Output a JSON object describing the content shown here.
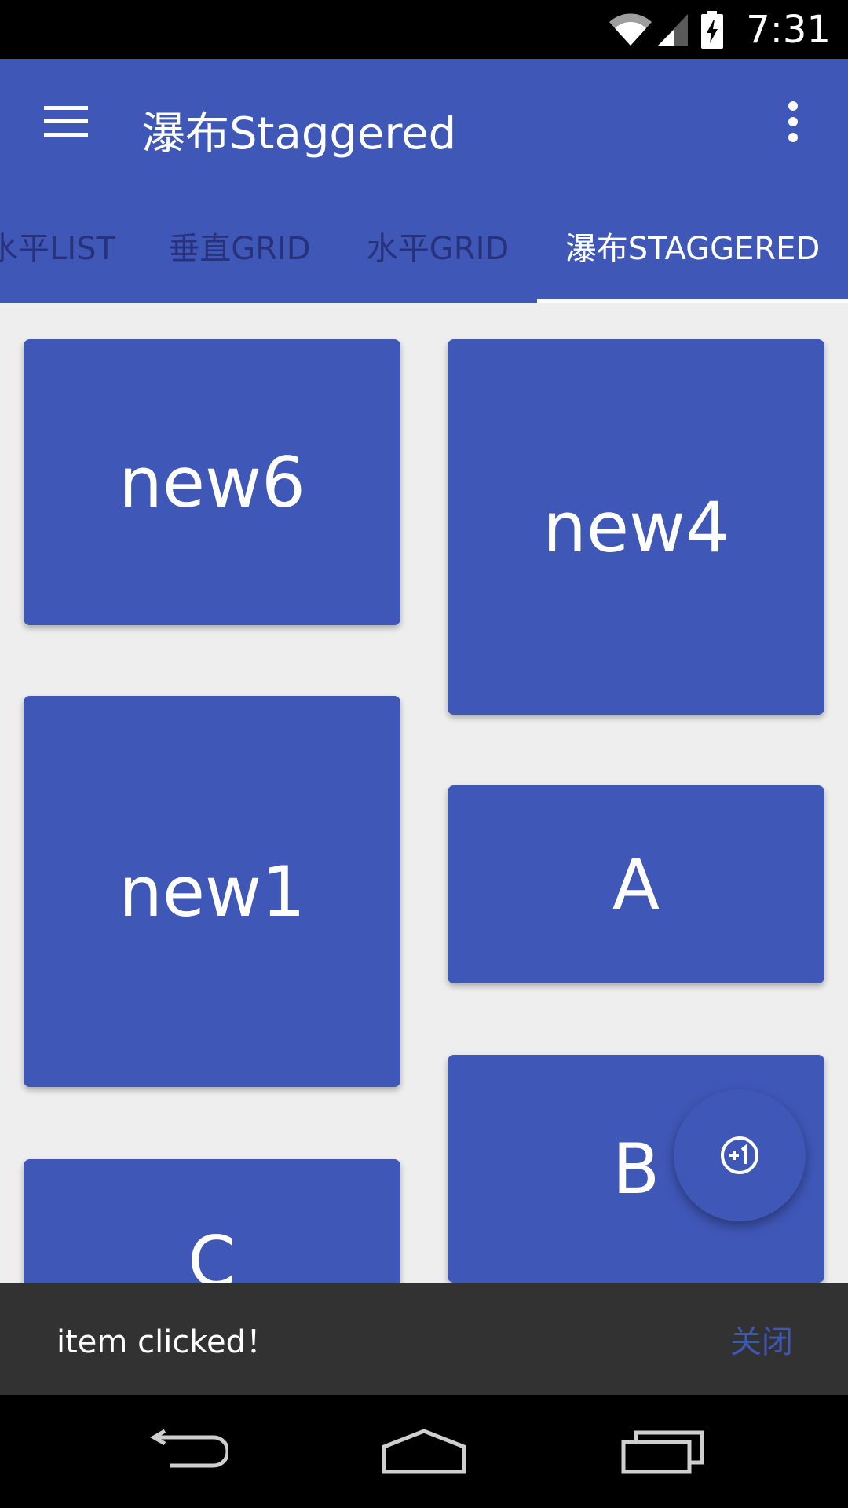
{
  "status_bar": {
    "time": "7:31",
    "icons": [
      "wifi-icon",
      "cell-signal-icon",
      "battery-charging-icon"
    ]
  },
  "toolbar": {
    "title": "瀑布Staggered",
    "menu_icon": "hamburger-menu-icon",
    "overflow_icon": "more-vertical-icon"
  },
  "tabs": [
    {
      "label": "水平LIST",
      "active": false
    },
    {
      "label": "垂直GRID",
      "active": false
    },
    {
      "label": "水平GRID",
      "active": false
    },
    {
      "label": "瀑布STAGGERED",
      "active": true
    }
  ],
  "cards": [
    {
      "label": "new6"
    },
    {
      "label": "new4"
    },
    {
      "label": "new1"
    },
    {
      "label": "A"
    },
    {
      "label": "C"
    },
    {
      "label": "B"
    }
  ],
  "fab": {
    "icon": "plus-one-icon"
  },
  "snackbar": {
    "message": "item clicked！",
    "action": "关闭"
  },
  "nav_bar": {
    "icons": [
      "back-icon",
      "home-icon",
      "recents-icon"
    ]
  },
  "colors": {
    "primary": "#3f57b7",
    "tab_inactive": "#27327a",
    "background": "#eeeeee",
    "snackbar": "#323232"
  }
}
